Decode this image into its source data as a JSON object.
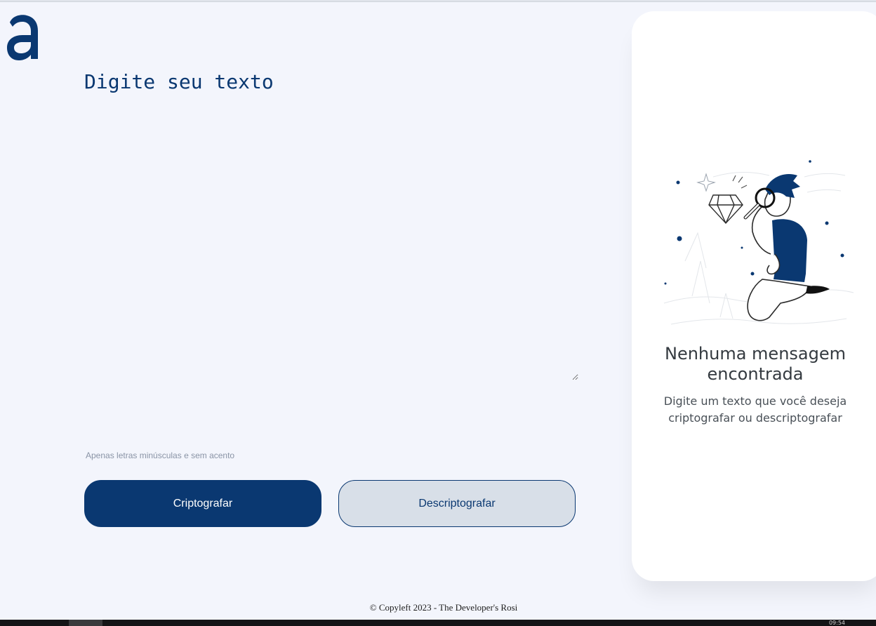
{
  "logo": {
    "alt": "a"
  },
  "editor": {
    "placeholder": "Digite seu texto"
  },
  "hint": {
    "text": "Apenas letras minúsculas e sem acento"
  },
  "buttons": {
    "encrypt": "Criptografar",
    "decrypt": "Descriptografar"
  },
  "panel": {
    "title": "Nenhuma mensagem encontrada",
    "subtitle": "Digite um texto que você deseja criptografar ou descriptografar"
  },
  "footer": {
    "text": "© Copyleft 2023 - The Developer's Rosi"
  },
  "taskbar": {
    "clock": "09:54"
  },
  "colors": {
    "brand": "#0a3871",
    "background": "#f3f5fc",
    "secondary_button": "#d8dfe8",
    "panel": "#ffffff"
  }
}
